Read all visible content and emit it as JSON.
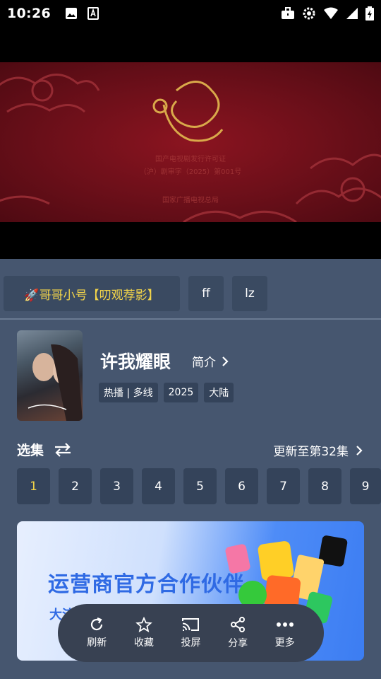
{
  "status_bar": {
    "time": "10:26"
  },
  "player": {
    "license_line1": "国产电视剧发行许可证",
    "license_line2": "（沪）剧审字（2025）第001号",
    "license_line3": "国家广播电视总局"
  },
  "sources": [
    "🚀哥哥小号【叨观荐影】",
    "ff",
    "lz"
  ],
  "show": {
    "title": "许我耀眼",
    "intro_label": "简介",
    "tags": [
      "热播 | 多线",
      "2025",
      "大陆"
    ]
  },
  "episodes": {
    "heading": "选集",
    "update_text": "更新至第32集",
    "items": [
      "1",
      "2",
      "3",
      "4",
      "5",
      "6",
      "7",
      "8",
      "9"
    ],
    "current": "1"
  },
  "banner": {
    "headline": "运营商官方合作伙伴",
    "subline": "大流"
  },
  "toolbar": {
    "refresh": "刷新",
    "favorite": "收藏",
    "cast": "投屏",
    "share": "分享",
    "more": "更多"
  },
  "colors": {
    "accent": "#f2d44a",
    "background": "#46566f",
    "chip": "#34435a"
  }
}
